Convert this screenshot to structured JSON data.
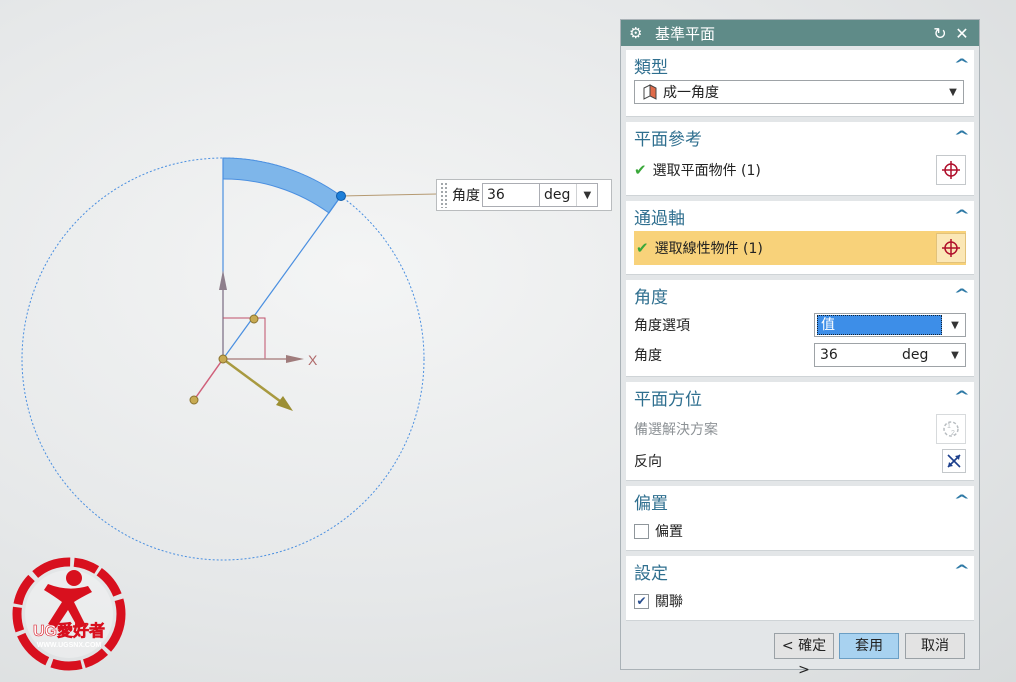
{
  "floating_input": {
    "label": "角度",
    "value": "36",
    "unit": "deg"
  },
  "viewport": {
    "axis_label": "X"
  },
  "dialog": {
    "title": "基準平面",
    "sections": {
      "type": {
        "header": "類型",
        "selected": "成一角度"
      },
      "plane_ref": {
        "header": "平面參考",
        "item": "選取平面物件 (1)"
      },
      "through_axis": {
        "header": "通過軸",
        "item": "選取線性物件 (1)"
      },
      "angle": {
        "header": "角度",
        "option_label": "角度選項",
        "option_value": "值",
        "angle_label": "角度",
        "angle_value": "36",
        "angle_unit": "deg"
      },
      "orientation": {
        "header": "平面方位",
        "alt_solution": "備選解決方案",
        "reverse": "反向"
      },
      "offset": {
        "header": "偏置",
        "checkbox_label": "偏置",
        "checked": false
      },
      "settings": {
        "header": "設定",
        "checkbox_label": "關聯",
        "checked": true
      }
    },
    "buttons": {
      "ok": "< 確定 >",
      "apply": "套用",
      "cancel": "取消"
    }
  },
  "logo": {
    "text": "UG愛好者",
    "url_text": "WWW.UGSNX.COM"
  },
  "colors": {
    "title_bar": "#5f8b88",
    "section_header": "#2f6f8f",
    "highlight_row": "#f8d27a",
    "selected_field": "#3d8ee8",
    "apply_button": "#a8d2f0"
  }
}
